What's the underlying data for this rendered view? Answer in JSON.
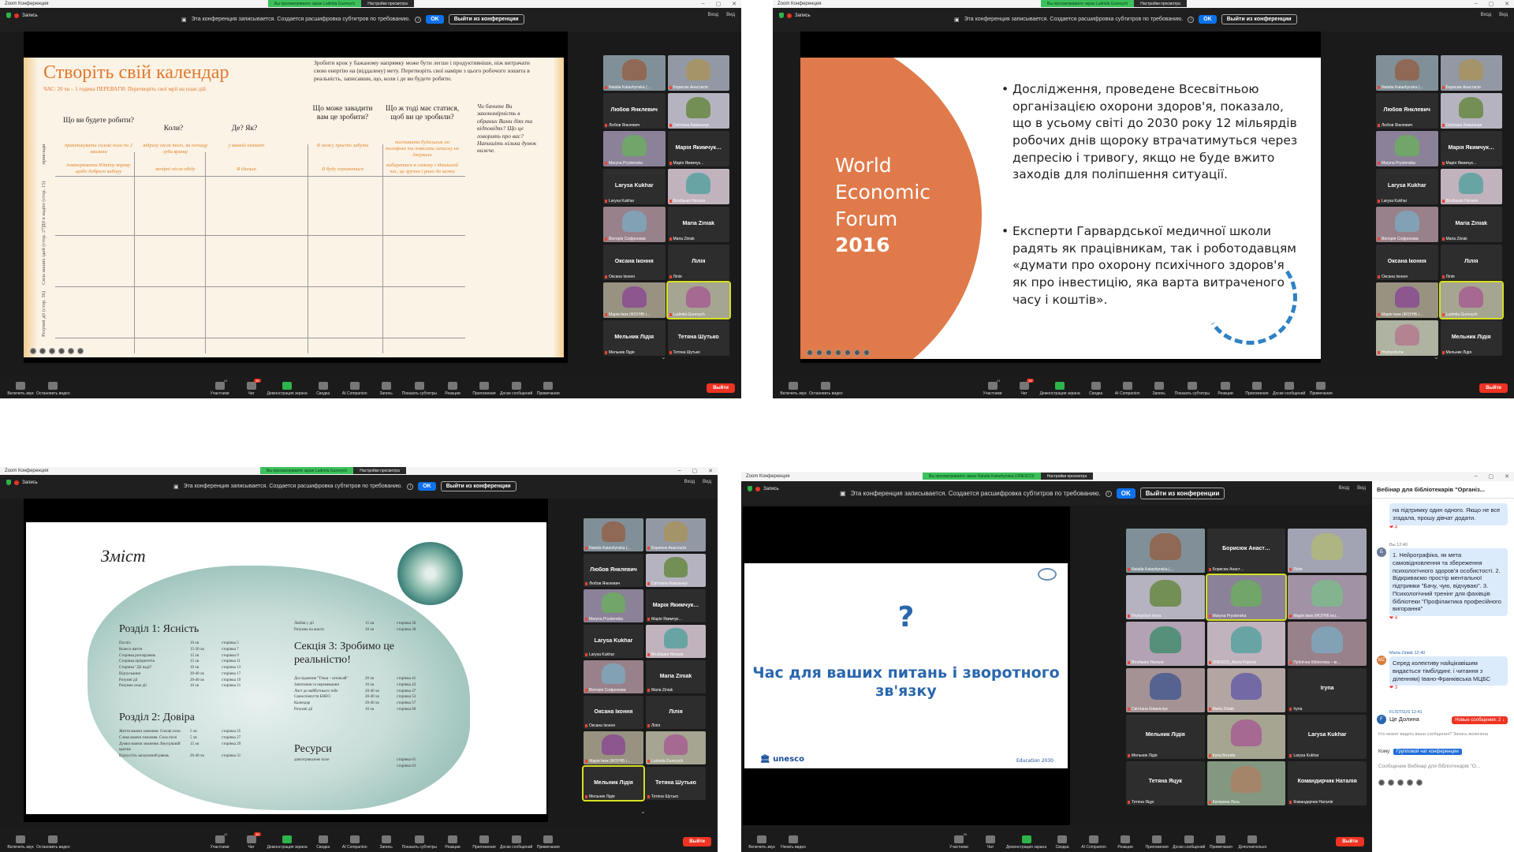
{
  "zoom_title": "Zoom Конференция",
  "share_view": "Вы просматриваете экран Ludmila Gurevych",
  "share_view_4": "Вы просматриваете экран Natalia Katashynska (UNESCO)",
  "view_options": "Настройки просмотра",
  "recording_label": "Запись",
  "recording_banner": "Эта конференция записывается. Создается расшифровка субтитров по требованию.",
  "ok_label": "OK",
  "leave_meeting_label": "Выйти из конференции",
  "view_ctrl": [
    "Вход",
    "Вид"
  ],
  "toolbar": [
    {
      "label": "Включить звук",
      "icon": "mic-muted-icon"
    },
    {
      "label": "Остановить видео",
      "icon": "video-icon"
    },
    {
      "label": "Участники",
      "icon": "participants-icon",
      "count": "41"
    },
    {
      "label": "Чат",
      "icon": "chat-icon",
      "badge": "35"
    },
    {
      "label": "Демонстрация экрана",
      "icon": "share-screen-icon"
    },
    {
      "label": "Сводка",
      "icon": "summary-icon"
    },
    {
      "label": "AI Companion",
      "icon": "ai-companion-icon"
    },
    {
      "label": "Запись",
      "icon": "record-icon"
    },
    {
      "label": "Показать субтитры",
      "icon": "captions-icon"
    },
    {
      "label": "Реакции",
      "icon": "reactions-icon"
    },
    {
      "label": "Приложения",
      "icon": "apps-icon"
    },
    {
      "label": "Доски сообщений",
      "icon": "whiteboards-icon"
    },
    {
      "label": "Примечания",
      "icon": "notes-icon"
    }
  ],
  "toolbar4": [
    {
      "label": "Включить звук",
      "icon": "mic-muted-icon"
    },
    {
      "label": "Начать видео",
      "icon": "video-off-icon"
    },
    {
      "label": "Участники",
      "icon": "participants-icon",
      "count": "30"
    },
    {
      "label": "Чат",
      "icon": "chat-icon"
    },
    {
      "label": "Демонстрация экрана",
      "icon": "share-screen-icon"
    },
    {
      "label": "Сводка",
      "icon": "summary-icon"
    },
    {
      "label": "AI Companion",
      "icon": "ai-companion-icon"
    },
    {
      "label": "Реакции",
      "icon": "reactions-icon"
    },
    {
      "label": "Приложения",
      "icon": "apps-icon"
    },
    {
      "label": "Доски сообщений",
      "icon": "whiteboards-icon"
    },
    {
      "label": "Примечания",
      "icon": "notes-icon"
    },
    {
      "label": "Дополнительно",
      "icon": "more-icon"
    }
  ],
  "exit_label": "Выйти",
  "participants_a": [
    "Natalia Katashynska (…",
    "Борисюк Анастасія",
    "Любов Янклевич",
    "Світлана Ковальчук",
    "Maryna Prystenska",
    "Марія Якимчук…",
    "Larysa Kukhar",
    "Вітзбанко Наталя",
    "Вікторія Софронова",
    "Maria Ziniak",
    "Оксана Іконня",
    "Лілія",
    "Марія Іжок (ФОУНБ і…",
    "Ludmila Gurevych",
    "Мельник Лідія",
    "Тетяна Шутько"
  ],
  "participants_b": [
    "Natalia Katashynska (…",
    "Борисюк Анастасія",
    "Любов Янклевич",
    "Світлана Ковальчук",
    "Maryna Prystenska",
    "Марія Якимчук…",
    "Larysa Kukhar",
    "Вітзбанко Наталя",
    "Вікторія Софронова",
    "Maria Ziniak",
    "Оксана Іконня",
    "Лілія",
    "Марія Іжок (ФОУНБ і…",
    "Ludmila Gurevych",
    "Hrytsyshyna",
    "Мельник Лідія"
  ],
  "participants_d": [
    "Natalia Katashynska (…",
    "Борисюк Анаст…",
    "Лілія",
    "Hrytsyshyn Iryna",
    "Maryna Prystenska",
    "Марія Іжок (ФОУНБ ім.і…",
    "Вітзбанко Наталя",
    "UNESCO_Alona Fopova",
    "Публічна бібліотека – м…",
    "Світлана Ковальчук",
    "Maria Ziniak",
    "Iryna",
    "Мельник Лідія",
    "Iryna Brunda",
    "Larysa Kukhar",
    "Тетяна Яцук",
    "Катерина Лесь",
    "Командирчик Наталія"
  ],
  "slide1": {
    "title": "Створіть свій календар",
    "subtitle": "ЧАС: 20 хв – 1 година ПЕРЕВАГИ: Перетворіть свої мрії на план дій.",
    "intro": "Зробити крок у бажаному напрямку може бути легше і продуктивніше, ніж витрачати свою енергію на (віддалену) мету. Перетворіть свої наміри з цього робочого зошита в реальність, записавши, що, коли і де ви будете робити.",
    "cols": [
      "Що ви будете робити?",
      "Коли?",
      "Де? Як?",
      "Що може завадити вам це зробити?",
      "Що ж тоді має статися, щоб ви це зробили?"
    ],
    "hints": [
      "практикувати силові поза по 2 хвилини",
      "відразу після того, як почищу зуби вранці",
      "у ванній кімнаті",
      "Я можу просто забути",
      "поставити будильник на телефоні та повісити записку на дзеркало"
    ],
    "hints2": [
      "повторювати Ютіту вправу щодо доброго вибору",
      "вечірні після обіду",
      "В їдальні",
      "Я буду соромитися",
      "вибиратися в самому і ідеальний час, це зручно і рано до шоти"
    ],
    "note": "Чи бачите Ви закономірність в обраних Вами діях та відповідях? Що це говорить про вас? Напишіть кілька думок нижче.",
    "rows": [
      "приклади",
      "Дії в надію (стор. 15)",
      "Сила наших ідей (стор. 27)",
      "Розумні дії (стор. 36)"
    ]
  },
  "slide2": {
    "wef": [
      "World",
      "Economic",
      "Forum",
      "2016"
    ],
    "bullets": [
      "Дослідження, проведене Всесвітньою організацією охорони здоров'я, показало, що в усьому світі до 2030 року 12 мільярдів робочих днів щороку втрачатимуться через депресію і тривогу, якщо не буде вжито заходів для поліпшення ситуації.",
      "Експерти Гарвардської медичної школи радять як працівникам, так і роботодавцям «думати про охорону психічного здоров'я як про інвестицію, яка варта витраченого часу і коштів»."
    ]
  },
  "slide3": {
    "title": "Зміст",
    "s1": "Розділ 1: Ясність",
    "s1_rows": [
      [
        "Поспіх",
        "10 хв",
        "сторінка 5"
      ],
      [
        "Колесо життя",
        "15-30 хв",
        "сторінка 7"
      ],
      [
        "Сторінка розчарувань",
        "15 хв",
        "сторінка 9"
      ],
      [
        "Сторінка пріоритетів",
        "15 хв",
        "сторінка 11"
      ],
      [
        "Сторінка \"Дії надії\"",
        "10 хв",
        "сторінка 13"
      ],
      [
        "Відпускання",
        "20-40 хв",
        "сторінка 17"
      ],
      [
        "Розумні дії",
        "20-40 хв",
        "сторінка 19"
      ],
      [
        "Розумна сила дії",
        "10 хв",
        "сторінка 21"
      ]
    ],
    "s2": "Розділ 2: Довіра",
    "s2_rows": [
      [
        "Життя маючи значення. Силові пози",
        "5 хв",
        "сторінка 25"
      ],
      [
        "Слова маючи значення. Сила пісні",
        "5 хв",
        "сторінка 27"
      ],
      [
        "Думки маючи значення. Внутрішній критик",
        "15 хв",
        "сторінка 29"
      ],
      [
        "Відпустіть засмучений рівень",
        "20-40 хв",
        "сторінка 31"
      ]
    ],
    "top_rows": [
      [
        "Любов у дії",
        "15 хв",
        "сторінка 36"
      ],
      [
        "Розумна на аналіз",
        "10 хв",
        "сторінка 38"
      ]
    ],
    "s3": "Секція 3: Зробимо це реальністю!",
    "s3_rows": [
      [
        "Дослідження \"Тіньи – штовхай\"",
        "20 хв",
        "сторінка 41"
      ],
      [
        "Запитання та перемикання",
        "10 хв",
        "сторінка 43"
      ],
      [
        "Лист до майбутнього тебе",
        "20-40 хв",
        "сторінка 47"
      ],
      [
        "Самоспівчуття БНЕО",
        "20-40 хв",
        "сторінка 53"
      ],
      [
        "Календар",
        "20-40 хв",
        "сторінка 57"
      ],
      [
        "Розумні дії",
        "10 хв",
        "сторінка 60"
      ]
    ],
    "res": "Ресурси",
    "res_rows": [
      [
        "довготривалене поле",
        "",
        "сторінка 61"
      ],
      [
        "",
        "",
        "сторінка 63"
      ]
    ]
  },
  "slide4": {
    "q": "?",
    "text": "Час для ваших питань і зворотного зв'язку",
    "unesco": "unesco",
    "edu": "Education 2030"
  },
  "chat": {
    "header": "Вебінар для бібліотекарів \"Організ...",
    "m0": "на підтримку один одного. Якщо не все згадала, прошу дівчат додати.",
    "m0_react": "❤ 4",
    "m1_meta": "Вы 12:40",
    "m1": "1. Нейрографіка, як мета самовідновлення та збереження психологічного здоров'я особистості. 2. Відкриваємо простір ментальної підтримки \"Бачу, чую, відчуваю\". 3. Психологічний тренінг для фахівців бібліотеки \"Профілактика професійного вигорання\"",
    "m1_react": "❤ 4",
    "m2_meta": "Maria Ziniak 12:40",
    "m2": "Серед колективу найцікавішим видається тімбілдинг. і читання з діленням) Івано-Франківська МЦБС",
    "m2_react": "❤ 3",
    "m3_meta": "FLISTSUS 12:41",
    "m3": "Це Долина",
    "new_msgs": "Новые сообщения: 2 ↓",
    "who_sees": "Кто может видеть ваши сообщения? Запись включена",
    "to_label": "Кому:",
    "to_target": "Групповой чат конференции",
    "input_ph": "Сообщение Вебінар для бібліотекарів \"О..."
  },
  "colors": {
    "accent": "#0e72ed",
    "green": "#2db44a",
    "red": "#e33333",
    "orange": "#e0782e",
    "blue": "#2a66ad"
  }
}
